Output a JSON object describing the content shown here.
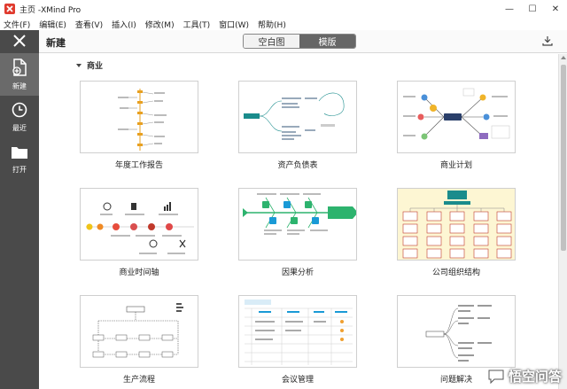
{
  "window": {
    "title": "主页 -XMind Pro",
    "controls": [
      "—",
      "☐",
      "✕"
    ]
  },
  "menu": [
    "文件(F)",
    "编辑(E)",
    "查看(V)",
    "插入(I)",
    "修改(M)",
    "工具(T)",
    "窗口(W)",
    "帮助(H)"
  ],
  "sidebar": {
    "items": [
      {
        "label": "新建",
        "icon": "new-file-icon"
      },
      {
        "label": "最近",
        "icon": "clock-icon"
      },
      {
        "label": "打开",
        "icon": "folder-icon"
      }
    ]
  },
  "header": {
    "title": "新建",
    "tabs": [
      "空白图",
      "模版"
    ],
    "active_tab": "模版"
  },
  "section": {
    "title": "商业"
  },
  "templates": [
    {
      "label": "年度工作报告"
    },
    {
      "label": "资产负债表"
    },
    {
      "label": "商业计划"
    },
    {
      "label": "商业时间轴"
    },
    {
      "label": "因果分析"
    },
    {
      "label": "公司组织结构"
    },
    {
      "label": "生产流程"
    },
    {
      "label": "会议管理"
    },
    {
      "label": "问题解决"
    }
  ],
  "watermark": {
    "text": "悟空问答"
  },
  "colors": {
    "sidebar": "#4a4a4a",
    "active_tab": "#666666",
    "accent_green": "#2db36e",
    "accent_teal": "#1a8c8c"
  }
}
